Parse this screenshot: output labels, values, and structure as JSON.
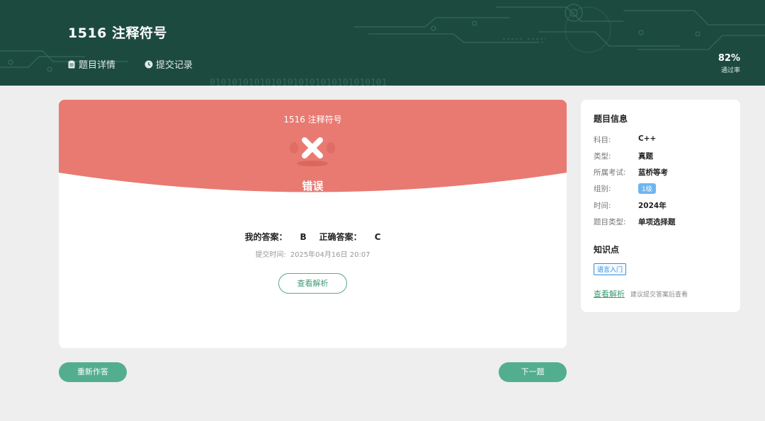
{
  "header": {
    "title": "1516 注释符号",
    "tabs": [
      {
        "label": "题目详情",
        "icon": "clipboard-icon"
      },
      {
        "label": "提交记录",
        "icon": "clock-icon"
      }
    ],
    "pass_rate": {
      "value": "82%",
      "label": "通过率"
    },
    "background_binary": "01010101010101010101010101010101"
  },
  "result": {
    "title": "1516 注释符号",
    "status": "错误",
    "status_icon": "cross-icon",
    "my_answer_label": "我的答案：",
    "my_answer": "B",
    "correct_answer_label": "正确答案：",
    "correct_answer": "C",
    "submit_time_label": "提交时间:",
    "submit_time": "2025年04月16日 20:07",
    "view_analysis": "查看解析"
  },
  "actions": {
    "redo": "重新作答",
    "next": "下一题"
  },
  "info": {
    "title": "题目信息",
    "rows": [
      {
        "key": "科目:",
        "value": "C++"
      },
      {
        "key": "类型:",
        "value": "真题"
      },
      {
        "key": "所属考试:",
        "value": "蓝桥等考"
      },
      {
        "key": "组别:",
        "value": "1级"
      },
      {
        "key": "时间:",
        "value": "2024年"
      },
      {
        "key": "题目类型:",
        "value": "单项选择题"
      }
    ],
    "knowledge_title": "知识点",
    "knowledge_tags": [
      "语言入门"
    ],
    "analysis_link": "查看解析",
    "analysis_hint": "建议提交答案后查看"
  },
  "colors": {
    "header_bg": "#1d4a3f",
    "error_red": "#e87a72",
    "accent_green": "#52ae8e",
    "badge_blue": "#6fb6f0"
  }
}
